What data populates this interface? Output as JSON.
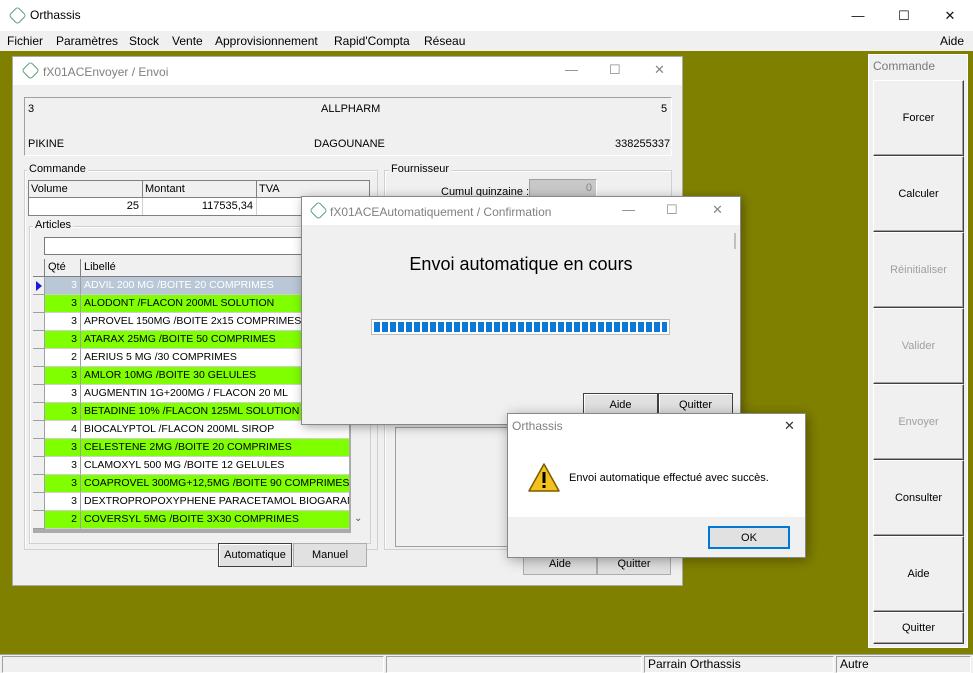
{
  "app": {
    "title": "Orthassis",
    "controls": {
      "minimize": "—",
      "maximize": "☐",
      "close": "✕"
    }
  },
  "menu": {
    "items": [
      "Fichier",
      "Paramètres",
      "Stock",
      "Vente",
      "Approvisionnement",
      "Rapid'Compta",
      "Réseau"
    ],
    "help": "Aide"
  },
  "status": {
    "cells": [
      "",
      "",
      "Parrain Orthassis",
      "Autre"
    ]
  },
  "command_panel": {
    "title": "Commande",
    "buttons": [
      {
        "label": "Forcer",
        "enabled": true
      },
      {
        "label": "Calculer",
        "enabled": true
      },
      {
        "label": "Réinitialiser",
        "enabled": false
      },
      {
        "label": "Valider",
        "enabled": false
      },
      {
        "label": "Envoyer",
        "enabled": false
      },
      {
        "label": "Consulter",
        "enabled": true
      },
      {
        "label": "Aide",
        "enabled": true
      },
      {
        "label": "Quitter",
        "enabled": true
      }
    ]
  },
  "envoi": {
    "title": "fX01ACEnvoyer / Envoi",
    "header": {
      "row1_left": "3",
      "row1_center": "ALLPHARM",
      "row1_right": "5",
      "row2_left": "PIKINE",
      "row2_center": "DAGOUNANE",
      "row2_right": "338255337"
    },
    "commande": {
      "label": "Commande",
      "volume_label": "Volume",
      "montant_label": "Montant",
      "tva_label": "TVA",
      "volume": "25",
      "montant": "117535,34",
      "tva": ""
    },
    "fournisseur": {
      "label": "Fournisseur",
      "cumul_label": "Cumul quinzaine :",
      "cumul_value": "0"
    },
    "articles": {
      "label": "Articles",
      "col_qte": "Qté",
      "col_libelle": "Libellé",
      "rows": [
        {
          "qte": "3",
          "libelle": "ADVIL 200 MG /BOITE 20 COMPRIMES",
          "style": "selected"
        },
        {
          "qte": "3",
          "libelle": "ALODONT /FLACON 200ML SOLUTION",
          "style": "green"
        },
        {
          "qte": "3",
          "libelle": "APROVEL 150MG /BOITE 2x15 COMPRIMES",
          "style": "white"
        },
        {
          "qte": "3",
          "libelle": "ATARAX 25MG /BOITE 50 COMPRIMES",
          "style": "green"
        },
        {
          "qte": "2",
          "libelle": "AERIUS 5 MG /30 COMPRIMES",
          "style": "white"
        },
        {
          "qte": "3",
          "libelle": "AMLOR 10MG /BOITE 30 GELULES",
          "style": "green"
        },
        {
          "qte": "3",
          "libelle": "AUGMENTIN 1G+200MG / FLACON 20 ML",
          "style": "white"
        },
        {
          "qte": "3",
          "libelle": "BETADINE 10% /FLACON 125ML SOLUTION",
          "style": "green"
        },
        {
          "qte": "4",
          "libelle": "BIOCALYPTOL /FLACON 200ML SIROP",
          "style": "white"
        },
        {
          "qte": "3",
          "libelle": "CELESTENE 2MG /BOITE 20 COMPRIMES",
          "style": "green"
        },
        {
          "qte": "3",
          "libelle": "CLAMOXYL 500 MG /BOITE 12 GELULES",
          "style": "white"
        },
        {
          "qte": "3",
          "libelle": "COAPROVEL 300MG+12,5MG /BOITE 90 COMPRIMES",
          "style": "green"
        },
        {
          "qte": "3",
          "libelle": "DEXTROPROPOXYPHENE PARACETAMOL BIOGARAN /E",
          "style": "white"
        },
        {
          "qte": "2",
          "libelle": "COVERSYL 5MG /BOITE 3X30 COMPRIMES",
          "style": "green"
        }
      ]
    },
    "btn_automatique": "Automatique",
    "btn_manuel": "Manuel",
    "btn_aide": "Aide",
    "btn_quitter": "Quitter"
  },
  "confirmation": {
    "title": "fX01ACEAutomatiquement / Confirmation",
    "heading": "Envoi automatique en cours",
    "progress": 1.0,
    "btn_aide": "Aide",
    "btn_quitter": "Quitter"
  },
  "message": {
    "title": "Orthassis",
    "text": "Envoi automatique effectué avec succès.",
    "ok": "OK"
  }
}
